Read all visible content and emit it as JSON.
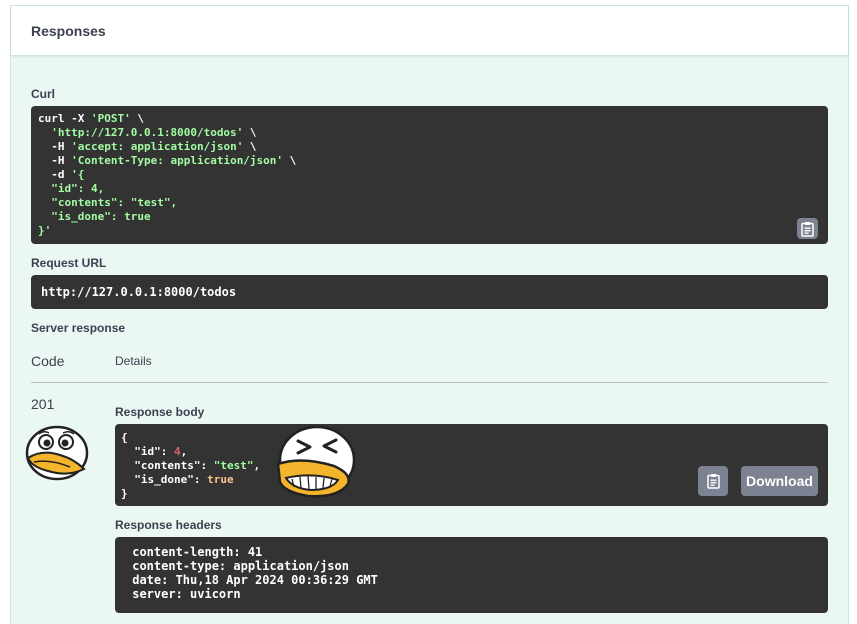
{
  "section_title": "Responses",
  "curl": {
    "label": "Curl",
    "lines": [
      [
        {
          "t": "curl -X "
        },
        {
          "t": "'POST'",
          "c": "s"
        },
        {
          "t": " \\"
        }
      ],
      [
        {
          "t": "  "
        },
        {
          "t": "'http://127.0.0.1:8000/todos'",
          "c": "s"
        },
        {
          "t": " \\"
        }
      ],
      [
        {
          "t": "  -H "
        },
        {
          "t": "'accept: application/json'",
          "c": "s"
        },
        {
          "t": " \\"
        }
      ],
      [
        {
          "t": "  -H "
        },
        {
          "t": "'Content-Type: application/json'",
          "c": "s"
        },
        {
          "t": " \\"
        }
      ],
      [
        {
          "t": "  -d "
        },
        {
          "t": "'{",
          "c": "s"
        }
      ],
      [
        {
          "t": "  \"id\": 4,",
          "c": "s"
        }
      ],
      [
        {
          "t": "  \"contents\": \"test\",",
          "c": "s"
        }
      ],
      [
        {
          "t": "  \"is_done\": true",
          "c": "s"
        }
      ],
      [
        {
          "t": "}'",
          "c": "s"
        }
      ]
    ]
  },
  "request_url": {
    "label": "Request URL",
    "value": "http://127.0.0.1:8000/todos"
  },
  "server_response": {
    "label": "Server response",
    "code_header": "Code",
    "details_header": "Details",
    "code": "201",
    "body_label": "Response body",
    "body_lines": [
      [
        {
          "t": "{"
        }
      ],
      [
        {
          "t": "  \"id\": "
        },
        {
          "t": "4",
          "c": "n"
        },
        {
          "t": ","
        }
      ],
      [
        {
          "t": "  \"contents\": "
        },
        {
          "t": "\"test\"",
          "c": "s"
        },
        {
          "t": ","
        }
      ],
      [
        {
          "t": "  \"is_done\": "
        },
        {
          "t": "true",
          "c": "k"
        }
      ],
      [
        {
          "t": "}"
        }
      ]
    ],
    "download_label": "Download",
    "headers_label": "Response headers",
    "headers_lines": [
      " content-length: 41 ",
      " content-type: application/json ",
      " date: Thu,18 Apr 2024 00:36:29 GMT ",
      " server: uvicorn "
    ]
  },
  "icons": {
    "copy": "clipboard-copy-icon",
    "sticker_worried": "duck-worried-sticker",
    "sticker_laughing": "duck-laughing-sticker"
  },
  "colors": {
    "panel_bg": "#ebf7f3",
    "code_bg": "#333333",
    "string": "#a2fca2",
    "number": "#d36363",
    "keyword": "#fcc28c",
    "button": "#7d8293"
  }
}
